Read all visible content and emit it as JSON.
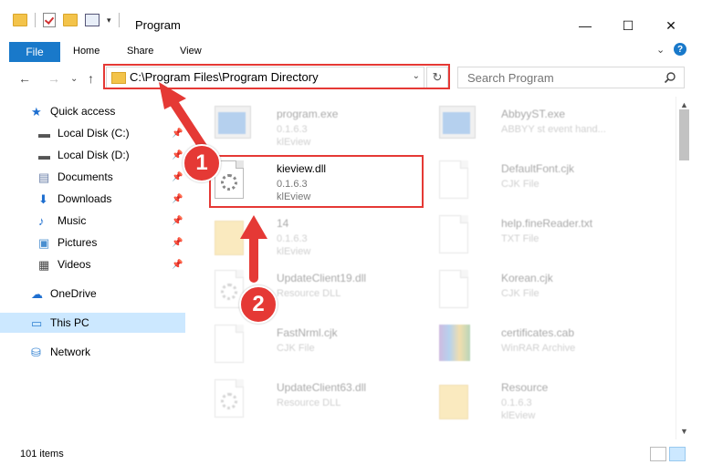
{
  "window": {
    "title": "Program",
    "minimize": "—",
    "maximize": "☐",
    "close": "✕"
  },
  "ribbon": {
    "file": "File",
    "home": "Home",
    "share": "Share",
    "view": "View",
    "expand": "⌄",
    "help": "?"
  },
  "navbar": {
    "back": "←",
    "forward": "→",
    "recent": "⌄",
    "up": "↑",
    "address": "C:\\Program Files\\Program Directory",
    "address_dropdown": "⌄",
    "refresh": "↻",
    "search_placeholder": "Search Program"
  },
  "nav_pane": {
    "items": [
      {
        "label": "Quick access",
        "icon": "star-icon"
      },
      {
        "label": "Local Disk (C:)",
        "icon": "drive-icon",
        "pinned": true
      },
      {
        "label": "Local Disk (D:)",
        "icon": "drive-icon",
        "pinned": true
      },
      {
        "label": "Documents",
        "icon": "documents-icon",
        "pinned": true
      },
      {
        "label": "Downloads",
        "icon": "download-icon",
        "pinned": true
      },
      {
        "label": "Music",
        "icon": "music-icon",
        "pinned": true
      },
      {
        "label": "Pictures",
        "icon": "pictures-icon",
        "pinned": true
      },
      {
        "label": "Videos",
        "icon": "videos-icon",
        "pinned": true
      },
      {
        "label": "OneDrive",
        "icon": "cloud-icon"
      },
      {
        "label": "This PC",
        "icon": "computer-icon",
        "selected": true
      },
      {
        "label": "Network",
        "icon": "network-icon"
      }
    ],
    "pin_glyph": "📌"
  },
  "files": [
    {
      "name": "program.exe",
      "line1": "0.1.6.3",
      "line2": "klEview",
      "icon": "exe-icon",
      "faded": true
    },
    {
      "name": "AbbyyST.exe",
      "line1": "ABBYY st event hand...",
      "line2": "",
      "icon": "exe-icon",
      "faded": true
    },
    {
      "name": "kieview.dll",
      "line1": "0.1.6.3",
      "line2": "klEview",
      "icon": "dll-icon",
      "faded": false
    },
    {
      "name": "DefaultFont.cjk",
      "line1": "CJK File",
      "line2": "",
      "icon": "file-icon",
      "faded": true
    },
    {
      "name": "14",
      "line1": "0.1.6.3",
      "line2": "klEview",
      "icon": "folder-icon",
      "faded": true
    },
    {
      "name": "help.fineReader.txt",
      "line1": "TXT File",
      "line2": "",
      "icon": "file-icon",
      "faded": true
    },
    {
      "name": "UpdateClient19.dll",
      "line1": "Resource DLL",
      "line2": "",
      "icon": "dll-icon",
      "faded": true
    },
    {
      "name": "Korean.cjk",
      "line1": "CJK File",
      "line2": "",
      "icon": "file-icon",
      "faded": true
    },
    {
      "name": "FastNrml.cjk",
      "line1": "CJK File",
      "line2": "",
      "icon": "file-icon",
      "faded": true
    },
    {
      "name": "certificates.cab",
      "line1": "WinRAR Archive",
      "line2": "",
      "icon": "winrar-icon",
      "faded": true
    },
    {
      "name": "UpdateClient63.dll",
      "line1": "Resource DLL",
      "line2": "",
      "icon": "dll-icon",
      "faded": true
    },
    {
      "name": "Resource",
      "line1": "0.1.6.3",
      "line2": "klEview",
      "icon": "folder-icon",
      "faded": true
    }
  ],
  "annotations": {
    "step1": "1",
    "step2": "2",
    "color": "#e53935"
  },
  "status": {
    "count": "101 items"
  }
}
